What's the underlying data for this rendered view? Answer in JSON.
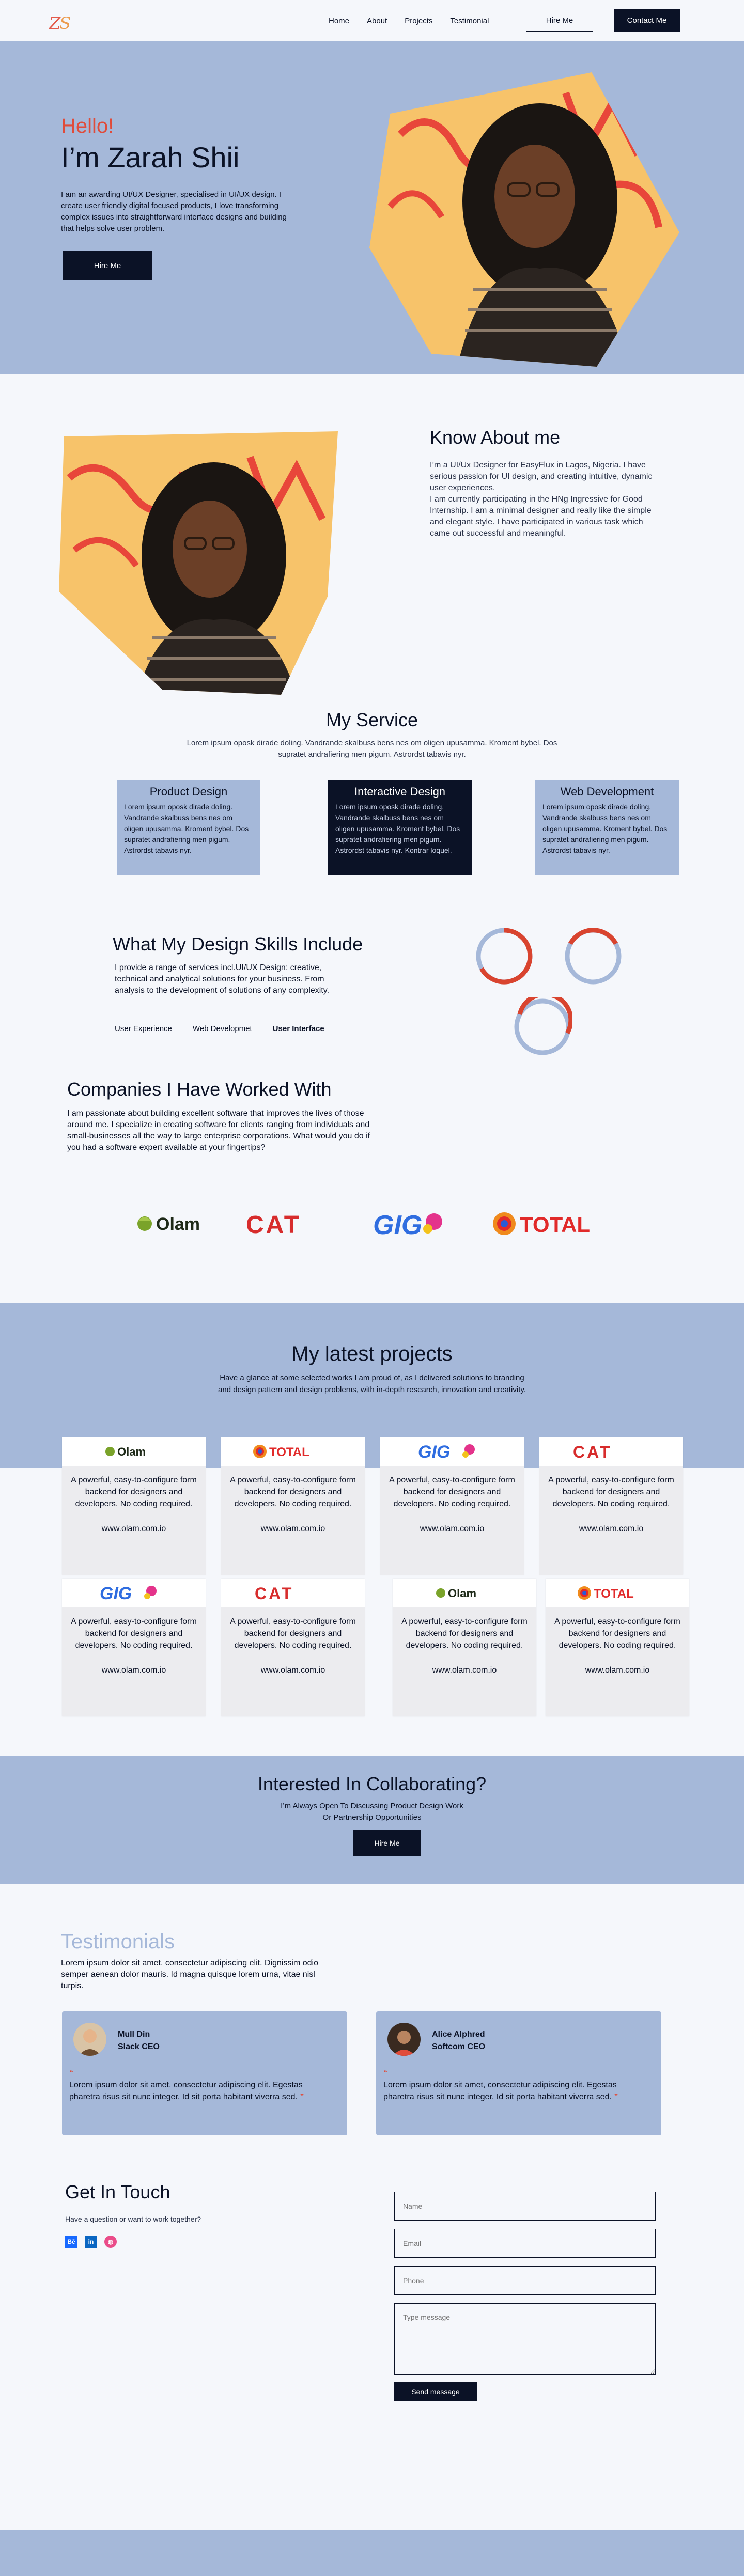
{
  "nav": {
    "logo": "ZS",
    "links": [
      "Home",
      "About",
      "Projects",
      "Testimonial"
    ],
    "hire_label": "Hire Me",
    "contact_label": "Contact Me"
  },
  "hero": {
    "hello": "Hello!",
    "name": "I’m Zarah Shii",
    "intro": "I am an awarding UI/UX Designer, specialised in UI/UX design. I create user friendly digital focused products, I love transforming complex issues into straightforward interface designs and building that helps solve user problem.",
    "button": "Hire Me"
  },
  "about": {
    "title": "Know About me",
    "p1": "I’m a UI/Ux Designer for EasyFlux in Lagos, Nigeria. I have serious passion for UI design,  and creating intuitive, dynamic user experiences.",
    "p2": "I am currently participating in the HNg Ingressive for Good Internship. I am a minimal designer and really like the simple and elegant style. I have participated in various task which came out successful and meaningful."
  },
  "services": {
    "title": "My Service",
    "subtitle": "Lorem ipsum oposk dirade doling. Vandrande skalbuss bens nes om oligen upusamma. Kroment bybel. Dos supratet andrafiering men pigum. Astrordst tabavis nyr.",
    "cards": [
      {
        "title": "Product Design",
        "text": "Lorem ipsum oposk dirade doling. Vandrande skalbuss bens nes om oligen upusamma. Kroment bybel. Dos supratet andrafiering men pigum. Astrordst tabavis nyr."
      },
      {
        "title": "Interactive Design",
        "text": "Lorem ipsum oposk dirade doling. Vandrande skalbuss bens nes om oligen upusamma. Kroment bybel. Dos supratet andrafiering men pigum. Astrordst tabavis nyr. Kontrar loquel."
      },
      {
        "title": "Web Development",
        "text": "Lorem ipsum oposk dirade doling. Vandrande skalbuss bens nes om oligen upusamma. Kroment bybel. Dos supratet andrafiering men pigum. Astrordst tabavis nyr."
      }
    ]
  },
  "skills": {
    "title": "What My Design Skills Include",
    "text": "I provide a range of services incl.UI/UX Design: creative, technical and analytical solutions for your business. From analysis to the development of solutions of any complexity.",
    "tabs": [
      "User Experience",
      "Web Developmet",
      "User Interface"
    ]
  },
  "companies": {
    "title": "Companies I Have Worked With",
    "text": "I am passionate about building excellent software that improves the lives of those around me. I specialize in creating software for clients ranging from individuals and small-businesses all the way to large enterprise corporations. What would you do if you had a software expert available at your fingertips?",
    "logos": [
      "Olam",
      "CAT",
      "GIG",
      "TOTAL"
    ]
  },
  "projects": {
    "title": "My latest projects",
    "subtitle": "Have a glance at some selected works I am proud of, as I delivered solutions to branding and design pattern and design problems, with in-depth research, innovation and creativity.",
    "card_text": "A powerful, easy-to-configure form backend for designers and developers. No coding required.",
    "card_url": "www.olam.com.io",
    "logos": [
      "Olam",
      "TOTAL",
      "GIG",
      "CAT",
      "GIG",
      "CAT",
      "Olam",
      "TOTAL"
    ]
  },
  "collab": {
    "title": "Interested In Collaborating?",
    "line1": "I’m Always Open To Discussing Product Design Work",
    "line2": "Or Partnership Opportunities",
    "button": "Hire Me"
  },
  "testimonials": {
    "title": "Testimonials",
    "subtitle": "Lorem ipsum dolor sit amet, consectetur adipiscing elit. Dignissim odio semper aenean dolor mauris. Id magna quisque lorem urna, vitae nisl turpis.",
    "items": [
      {
        "name": "Mull Din",
        "role": "Slack CEO",
        "quote": "Lorem ipsum dolor sit amet, consectetur adipiscing elit. Egestas pharetra risus sit nunc integer. Id sit porta habitant viverra sed."
      },
      {
        "name": "Alice Alphred",
        "role": "Softcom CEO",
        "quote": "Lorem ipsum dolor sit amet, consectetur adipiscing elit. Egestas pharetra risus sit nunc integer. Id sit porta habitant viverra sed."
      }
    ]
  },
  "contact": {
    "title": "Get In Touch",
    "subtitle": "Have a question or want to work together?",
    "placeholders": {
      "name": "Name",
      "email": "Email",
      "phone": "Phone",
      "message": "Type message"
    },
    "button": "Send message",
    "socials": [
      "behance-icon",
      "linkedin-icon",
      "dribbble-icon"
    ]
  },
  "colors": {
    "accent": "#a5b8d9",
    "dark": "#0b1226",
    "red": "#e04b3a"
  }
}
